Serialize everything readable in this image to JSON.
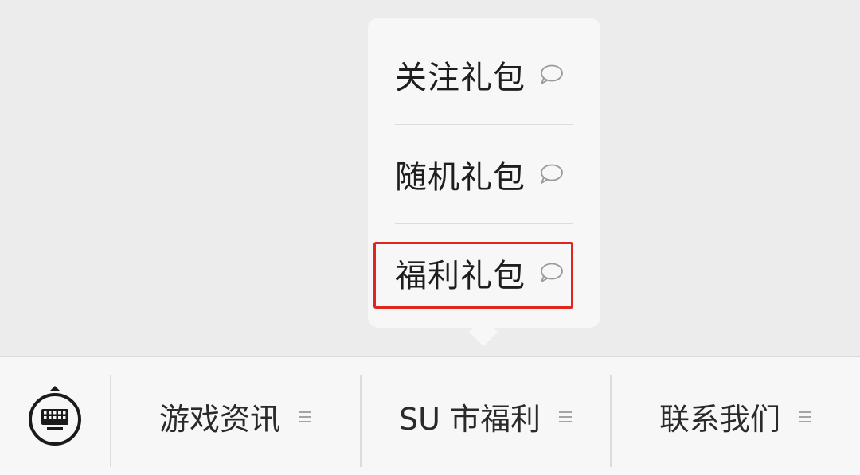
{
  "popup": {
    "items": [
      {
        "label": "关注礼包",
        "icon": "chat-bubble-icon"
      },
      {
        "label": "随机礼包",
        "icon": "chat-bubble-icon"
      },
      {
        "label": "福利礼包",
        "icon": "chat-bubble-icon"
      }
    ],
    "highlighted_index": 2
  },
  "menubar": {
    "keyboard_icon": "keyboard-icon",
    "items": [
      {
        "label": "游戏资讯",
        "icon": "menu-lines-icon"
      },
      {
        "label": "SU 市福利",
        "icon": "menu-lines-icon"
      },
      {
        "label": "联系我们",
        "icon": "menu-lines-icon"
      }
    ]
  },
  "colors": {
    "background": "#ececec",
    "panel": "#f7f7f7",
    "highlight": "#e0261f",
    "text": "#1e1e1e"
  }
}
